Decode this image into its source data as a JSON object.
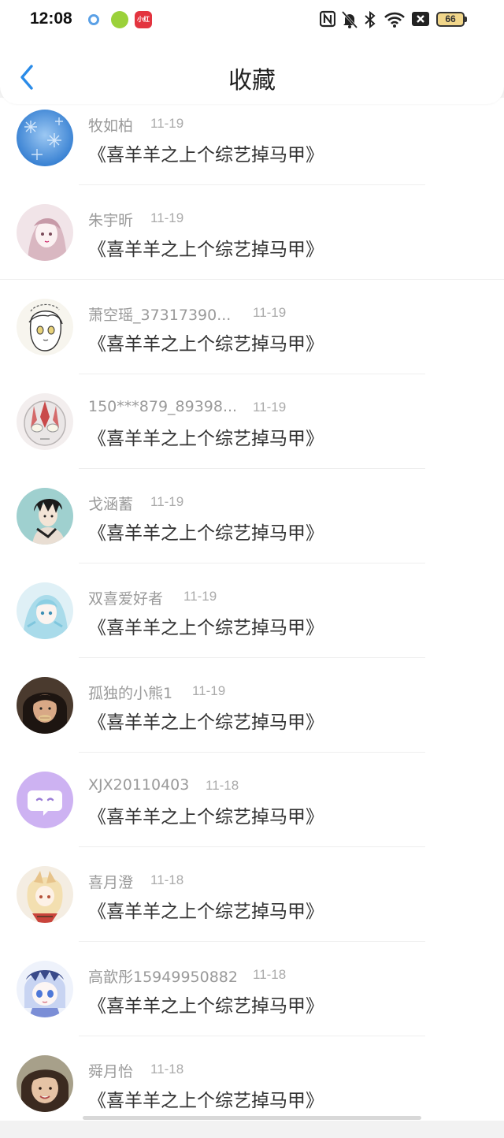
{
  "status_bar": {
    "time": "12:08",
    "apps": [
      "settings-app-icon",
      "kid-app-icon",
      "xiaohongshu-app-icon"
    ],
    "xhs_label": "小红书",
    "battery": "66"
  },
  "header": {
    "title": "收藏",
    "back_icon": "chevron-left-icon",
    "accent_color": "#2a8be8"
  },
  "items": [
    {
      "user": "牧如柏",
      "date": "11-19",
      "title": "《喜羊羊之上个综艺掉马甲》"
    },
    {
      "user": "朱宇昕",
      "date": "11-19",
      "title": "《喜羊羊之上个综艺掉马甲》"
    },
    {
      "user": "萧空瑶_37317390...",
      "date": "11-19",
      "title": "《喜羊羊之上个综艺掉马甲》"
    },
    {
      "user": "150***879_89398...",
      "date": "11-19",
      "title": "《喜羊羊之上个综艺掉马甲》"
    },
    {
      "user": "戈涵蓄",
      "date": "11-19",
      "title": "《喜羊羊之上个综艺掉马甲》"
    },
    {
      "user": "双喜爱好者",
      "date": "11-19",
      "title": "《喜羊羊之上个综艺掉马甲》"
    },
    {
      "user": "孤独的小熊1",
      "date": "11-19",
      "title": "《喜羊羊之上个综艺掉马甲》"
    },
    {
      "user": "XJX20110403",
      "date": "11-18",
      "title": "《喜羊羊之上个综艺掉马甲》"
    },
    {
      "user": "喜月澄",
      "date": "11-18",
      "title": "《喜羊羊之上个综艺掉马甲》"
    },
    {
      "user": "高歆彤15949950882",
      "date": "11-18",
      "title": "《喜羊羊之上个综艺掉马甲》"
    },
    {
      "user": "舜月怡",
      "date": "11-18",
      "title": "《喜羊羊之上个综艺掉马甲》"
    }
  ]
}
